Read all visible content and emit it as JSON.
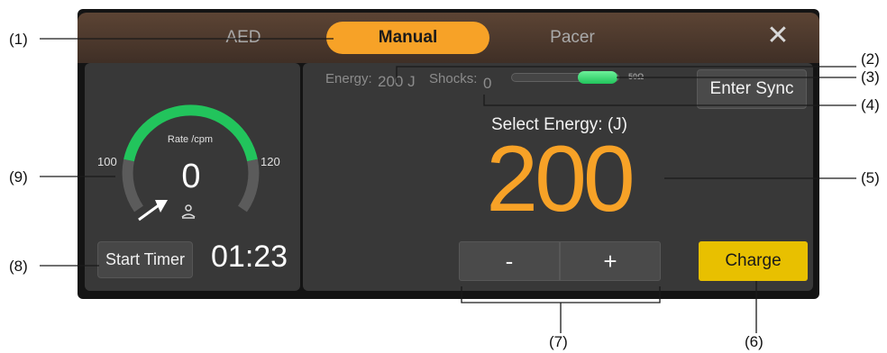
{
  "tabs": {
    "aed": "AED",
    "manual": "Manual",
    "pacer": "Pacer",
    "close_glyph": "✕"
  },
  "cpr": {
    "rate_label": "Rate /cpm",
    "rate_min": "100",
    "rate_max": "120",
    "rate_value": "0",
    "icon": "cpr-icon",
    "start_timer_label": "Start Timer",
    "timer_value": "01:23"
  },
  "status": {
    "energy_label": "Energy:",
    "energy_value": "200 J",
    "shocks_label": "Shocks:",
    "shocks_value": "0",
    "impedance_text": "50Ω",
    "enter_sync_label": "Enter Sync"
  },
  "energy": {
    "select_label": "Select Energy: (J)",
    "value": "200",
    "minus_label": "-",
    "plus_label": "+",
    "charge_label": "Charge"
  },
  "callouts": {
    "c1": "(1)",
    "c2": "(2)",
    "c3": "(3)",
    "c4": "(4)",
    "c5": "(5)",
    "c6": "(6)",
    "c7": "(7)",
    "c8": "(8)",
    "c9": "(9)"
  },
  "colors": {
    "accent_orange": "#f7a227",
    "gauge_green": "#22c45c",
    "charge_yellow": "#e8c000",
    "panel_gray": "#383838"
  }
}
